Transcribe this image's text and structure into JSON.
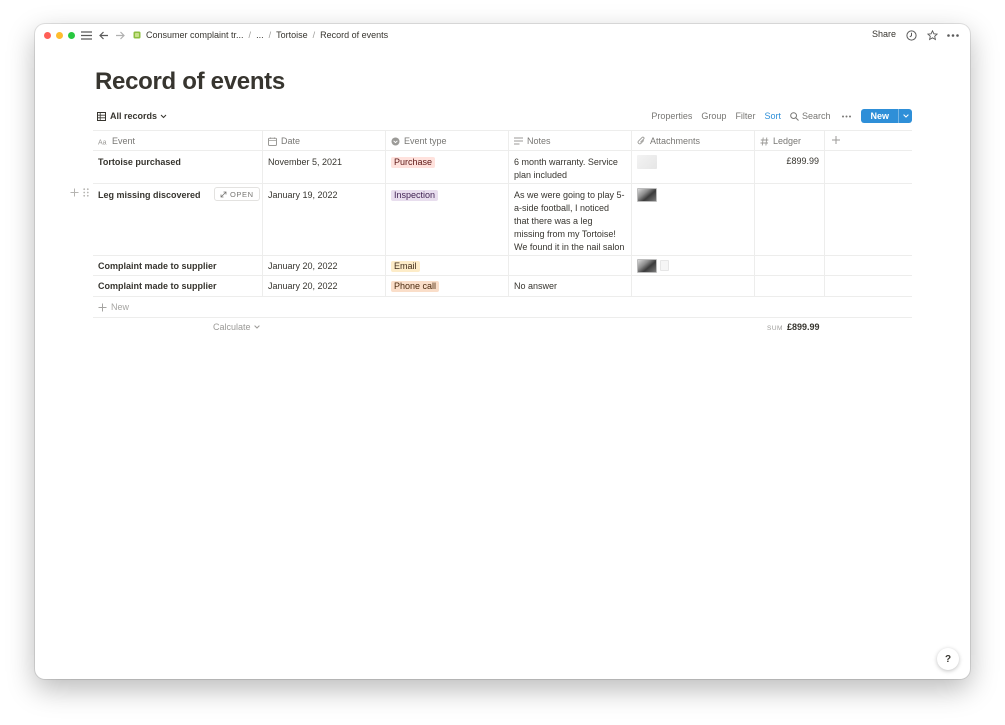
{
  "breadcrumb": {
    "items": [
      "Consumer complaint tr...",
      "...",
      "Tortoise",
      "Record of events"
    ],
    "separator": "/"
  },
  "topbar": {
    "share_label": "Share"
  },
  "page": {
    "title": "Record of events"
  },
  "view": {
    "tab_label": "All records",
    "actions": {
      "properties": "Properties",
      "group": "Group",
      "filter": "Filter",
      "sort": "Sort",
      "search": "Search"
    },
    "new_label": "New"
  },
  "table": {
    "columns": [
      {
        "label": "Event",
        "icon": "text-property-icon"
      },
      {
        "label": "Date",
        "icon": "calendar-icon"
      },
      {
        "label": "Event type",
        "icon": "select-icon"
      },
      {
        "label": "Notes",
        "icon": "lines-icon"
      },
      {
        "label": "Attachments",
        "icon": "paperclip-icon"
      },
      {
        "label": "Ledger",
        "icon": "hash-icon"
      }
    ],
    "rows": [
      {
        "event": "Tortoise purchased",
        "date": "November 5, 2021",
        "type": "Purchase",
        "notes": "6 month warranty. Service plan included",
        "ledger": "£899.99"
      },
      {
        "event": "Leg missing discovered",
        "date": "January 19, 2022",
        "type": "Inspection",
        "notes": "As we were going to play 5-a-side football, I noticed that there was a leg missing from my Tortoise! We found it in the nail salon",
        "ledger": "",
        "open_label": "OPEN"
      },
      {
        "event": "Complaint made to supplier",
        "date": "January 20, 2022",
        "type": "Email",
        "notes": "",
        "ledger": ""
      },
      {
        "event": "Complaint made to supplier",
        "date": "January 20, 2022",
        "type": "Phone call",
        "notes": "No answer",
        "ledger": ""
      }
    ],
    "new_row_label": "New",
    "calculate_label": "Calculate",
    "sum_label": "SUM",
    "sum_value": "£899.99"
  },
  "tag_colors": {
    "Purchase": {
      "bg": "#ffe2dd",
      "fg": "#5d1715"
    },
    "Inspection": {
      "bg": "#e8deee",
      "fg": "#412454"
    },
    "Email": {
      "bg": "#fdecc8",
      "fg": "#402c1b"
    },
    "Phone call": {
      "bg": "#fadec9",
      "fg": "#49290e"
    }
  },
  "help_label": "?"
}
